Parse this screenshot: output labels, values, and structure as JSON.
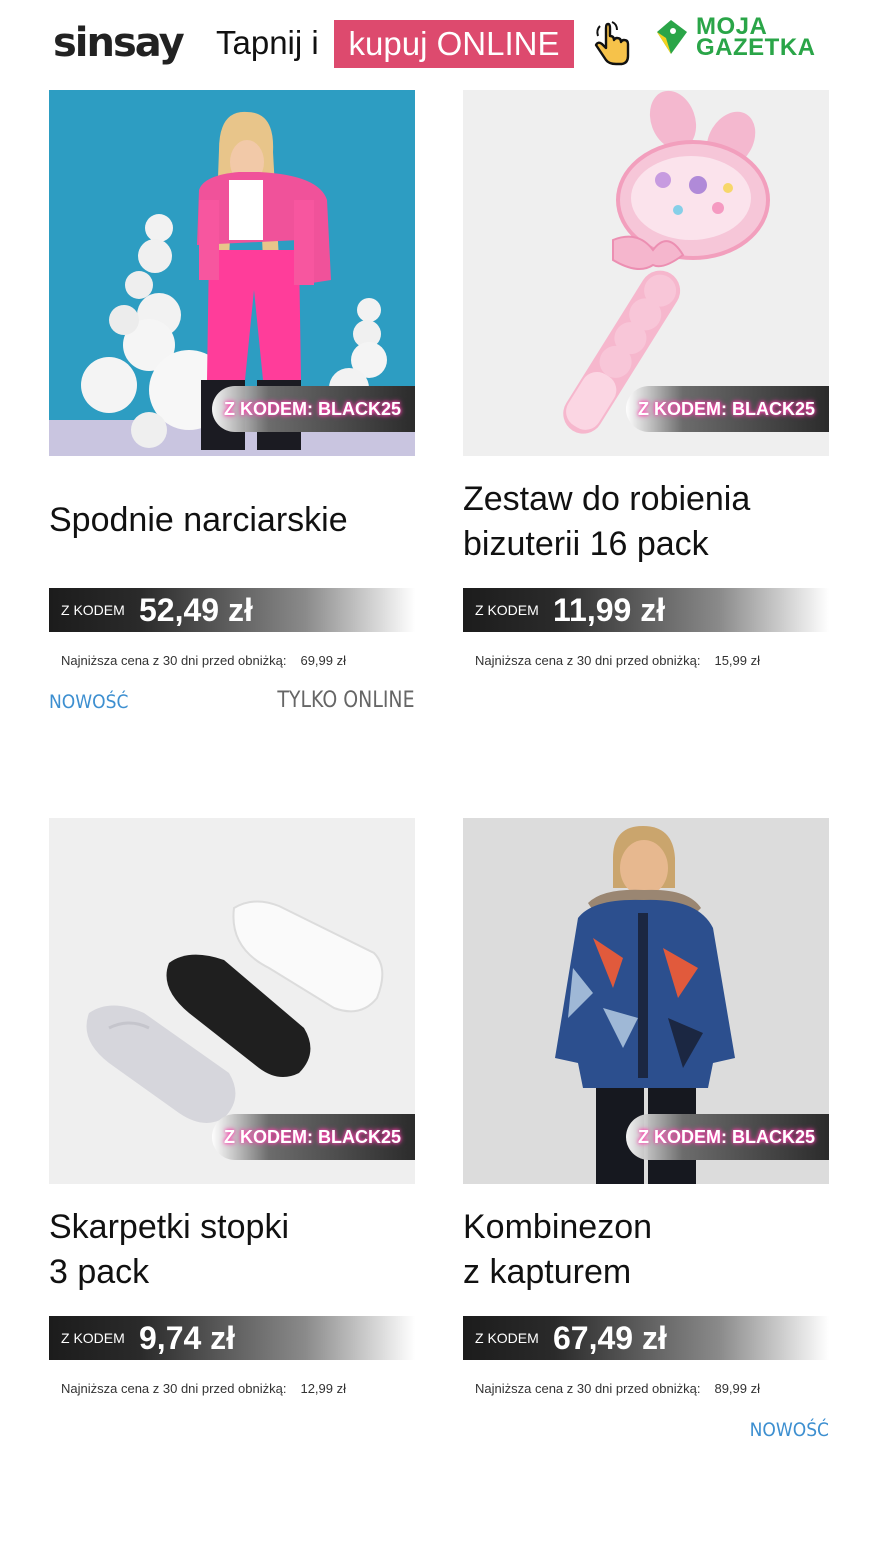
{
  "header": {
    "logo": "sinsay",
    "tap_text": "Tapnij i",
    "cta_text": "kupuj ONLINE",
    "hand_icon": "pointer-hand-icon",
    "gazetka_line1": "MOJA",
    "gazetka_line2": "GAZETKA",
    "gazetka_color": "#2aa548",
    "cta_color": "#dd4a6e"
  },
  "products": [
    {
      "badge": "Z KODEM: BLACK25",
      "title_line1": "Spodnie narciarskie",
      "title_line2": "",
      "price_label": "Z KODEM",
      "price": "52,49 zł",
      "lowest_label": "Najniższa cena z 30 dni przed obniżką:",
      "lowest_value": "69,99 zł",
      "tag_new": "NOWOŚĆ",
      "tag_online": "TYLKO ONLINE"
    },
    {
      "badge": "Z KODEM: BLACK25",
      "title_line1": "Zestaw do robienia",
      "title_line2": "bizuterii 16 pack",
      "price_label": "Z KODEM",
      "price": "11,99 zł",
      "lowest_label": "Najniższa cena z 30 dni przed obniżką:",
      "lowest_value": "15,99 zł",
      "tag_new": "",
      "tag_online": ""
    },
    {
      "badge": "Z KODEM: BLACK25",
      "title_line1": "Skarpetki stopki",
      "title_line2": "3 pack",
      "price_label": "Z KODEM",
      "price": "9,74 zł",
      "lowest_label": "Najniższa cena z 30 dni przed obniżką:",
      "lowest_value": "12,99 zł",
      "tag_new": "",
      "tag_online": ""
    },
    {
      "badge": "Z KODEM: BLACK25",
      "title_line1": "Kombinezon",
      "title_line2": "z kapturem",
      "price_label": "Z KODEM",
      "price": "67,49 zł",
      "lowest_label": "Najniższa cena z 30 dni przed obniżką:",
      "lowest_value": "89,99 zł",
      "tag_new": "NOWOŚĆ",
      "tag_online": ""
    }
  ]
}
